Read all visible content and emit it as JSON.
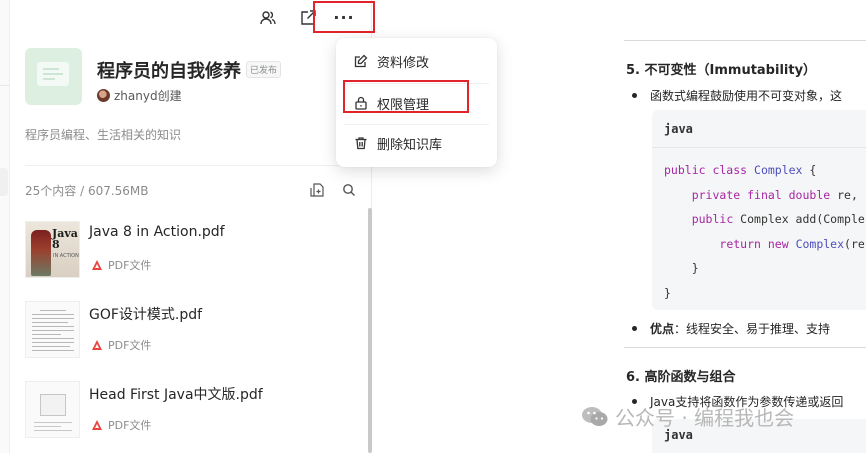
{
  "toolbar": {
    "more_label": "···"
  },
  "book": {
    "title": "程序员的自我修养",
    "status": "已发布",
    "creator": "zhanyd创建",
    "description": "程序员编程、生活相关的知识"
  },
  "list": {
    "summary": "25个内容 / 607.56MB",
    "items": [
      {
        "name": "Java 8 in Action.pdf",
        "type": "PDF文件",
        "thumb_title": "Java 8",
        "thumb_sub": "IN ACTION"
      },
      {
        "name": "GOF设计模式.pdf",
        "type": "PDF文件"
      },
      {
        "name": "Head First Java中文版.pdf",
        "type": "PDF文件"
      }
    ]
  },
  "menu": {
    "items": [
      {
        "label": "资料修改",
        "icon": "edit-icon"
      },
      {
        "label": "权限管理",
        "icon": "lock-icon"
      },
      {
        "label": "删除知识库",
        "icon": "trash-icon"
      }
    ]
  },
  "content": {
    "section5_heading": "5. 不可变性（Immutability）",
    "section5_bullet": "函数式编程鼓励使用不可变对象，这",
    "code1": {
      "lang": "java",
      "lines": [
        "public class Complex {",
        "    private final double re,",
        "    public Complex add(Comple",
        "        return new Complex(re",
        "    }",
        "}"
      ]
    },
    "advantage_label": "优点",
    "advantage_text": "：线程安全、易于推理、支持",
    "section6_heading": "6. 高阶函数与组合",
    "section6_bullet": "Java支持将函数作为参数传递或返回",
    "code2_lang": "java"
  },
  "watermark": "公众号 · 编程我也会",
  "colors": {
    "highlight_border": "#e0242a",
    "cover_bg": "#dcefe1",
    "pdf_red": "#e8453c"
  }
}
